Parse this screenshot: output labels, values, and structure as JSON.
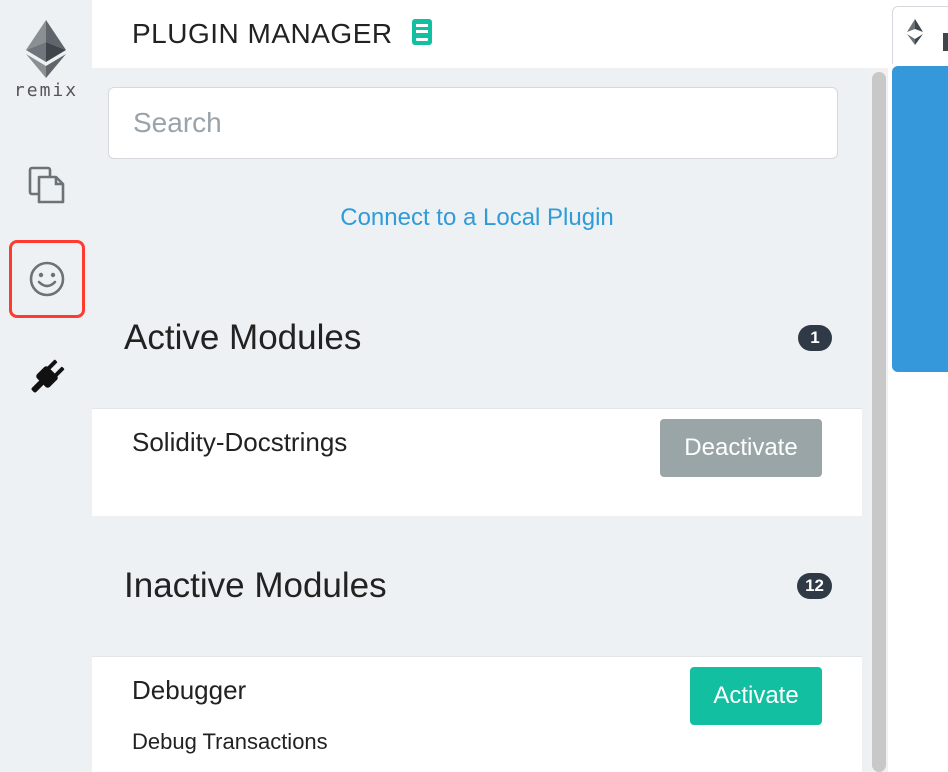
{
  "sidebar": {
    "logo_text": "remix",
    "icons": [
      "file-explorer-icon",
      "smiley-icon",
      "plugin-icon"
    ]
  },
  "header": {
    "title": "PLUGIN MANAGER"
  },
  "search": {
    "placeholder": "Search"
  },
  "connect_link": "Connect to a Local Plugin",
  "active_section": {
    "title": "Active Modules",
    "count": "1",
    "modules": [
      {
        "name": "Solidity-Docstrings",
        "button": "Deactivate"
      }
    ]
  },
  "inactive_section": {
    "title": "Inactive Modules",
    "count": "12",
    "modules": [
      {
        "name": "Debugger",
        "description": "Debug Transactions",
        "button": "Activate"
      }
    ]
  },
  "colors": {
    "accent_blue": "#2f9bd8",
    "activate_green": "#12bfa0",
    "deactivate_gray": "#9aa5a8",
    "badge_dark": "#2f3a46",
    "highlight_red": "#ff3b30"
  }
}
